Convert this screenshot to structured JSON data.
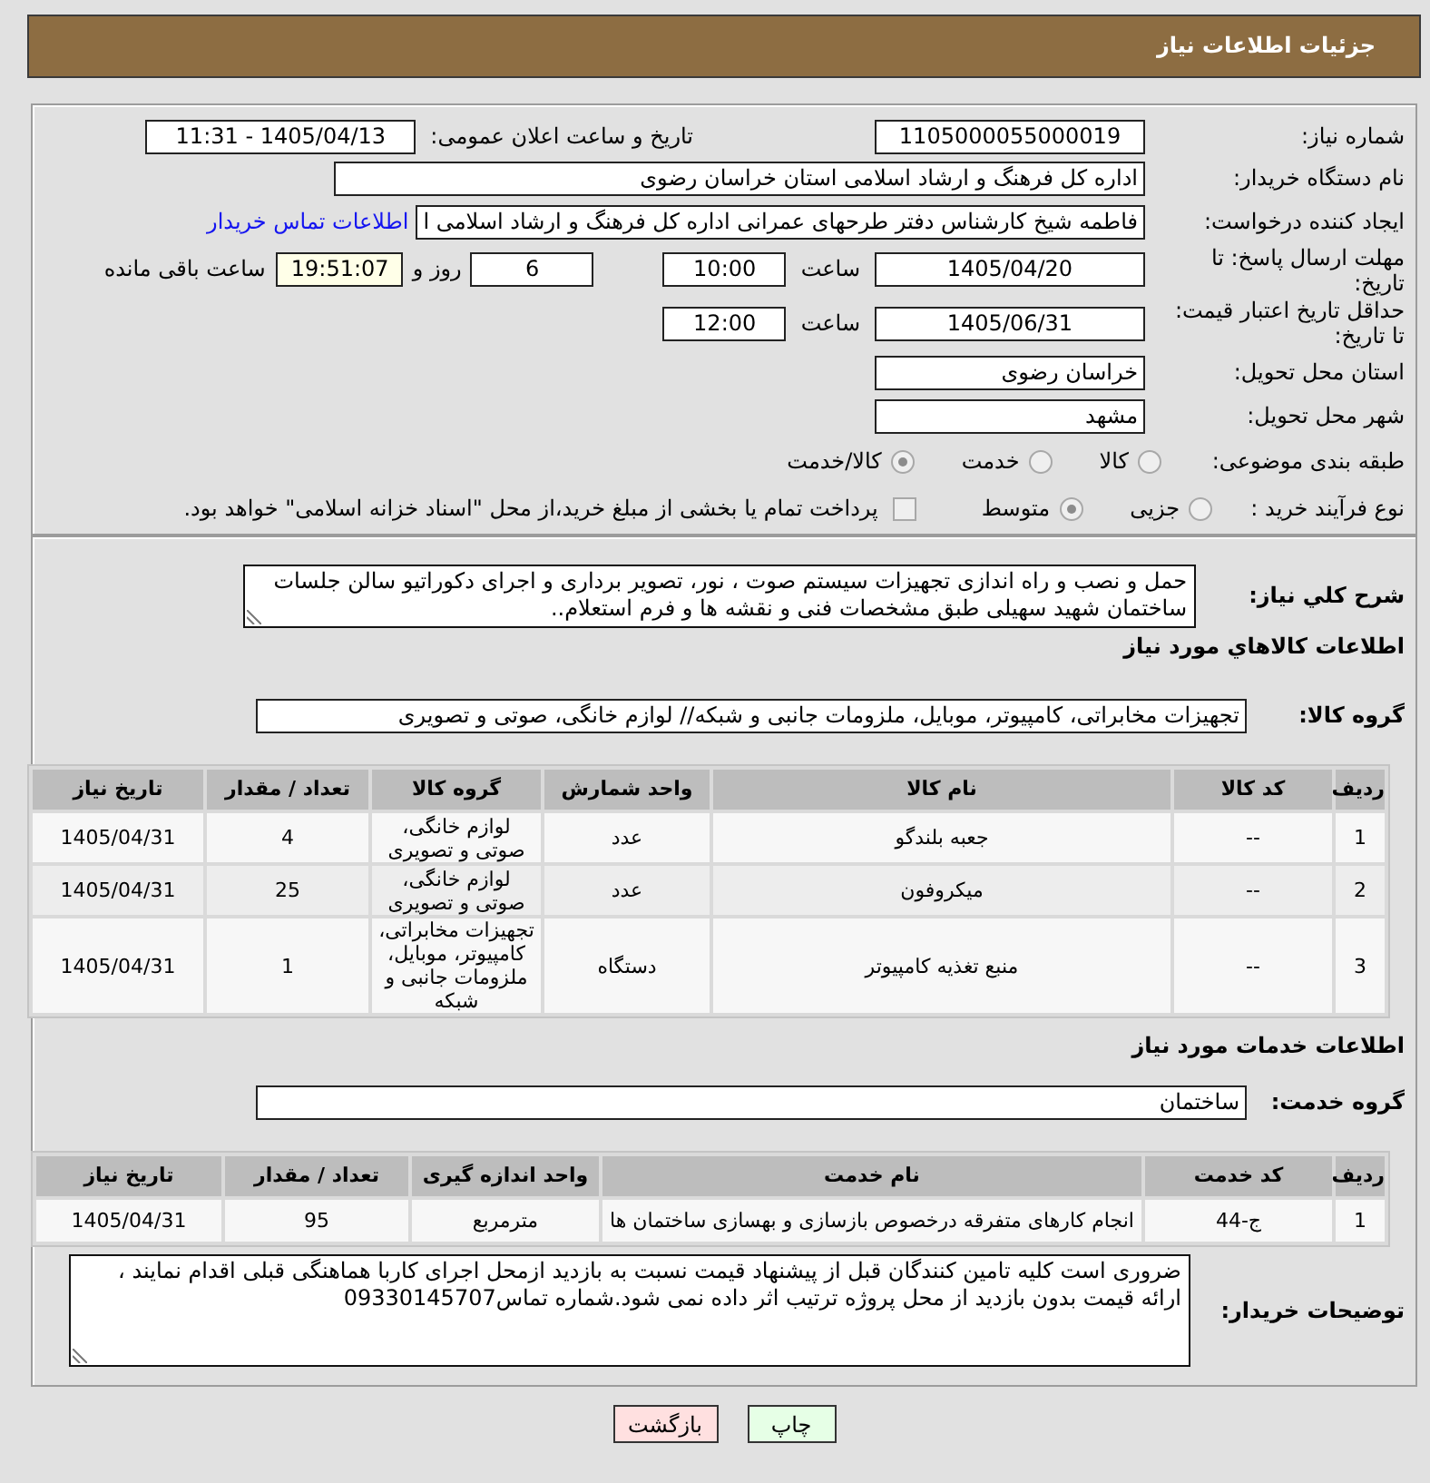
{
  "header": {
    "title": "جزئیات اطلاعات نیاز"
  },
  "details": {
    "need_number": {
      "label": "شماره نیاز:",
      "value": "1105000055000019"
    },
    "announce": {
      "label": "تاریخ و ساعت اعلان عمومی:",
      "value": "1405/04/13 - 11:31"
    },
    "buyer_org": {
      "label": "نام دستگاه خریدار:",
      "value": "اداره کل فرهنگ و ارشاد اسلامی استان خراسان رضوی"
    },
    "requester": {
      "label": "ایجاد کننده درخواست:",
      "value": "فاطمه شیخ کارشناس دفتر طرحهای عمرانی اداره کل فرهنگ و ارشاد اسلامی ا",
      "link": "اطلاعات تماس خریدار"
    },
    "reply_deadline": {
      "label": "مهلت ارسال پاسخ: تا تاریخ:",
      "date": "1405/04/20",
      "time_label": "ساعت",
      "time": "10:00",
      "days": "6",
      "days_label": "روز و",
      "remaining": "19:51:07",
      "remaining_label": "ساعت باقی مانده"
    },
    "price_validity": {
      "label": "حداقل تاریخ اعتبار قیمت: تا تاریخ:",
      "date": "1405/06/31",
      "time_label": "ساعت",
      "time": "12:00"
    },
    "province": {
      "label": "استان محل تحویل:",
      "value": "خراسان رضوی"
    },
    "city": {
      "label": "شهر محل تحویل:",
      "value": "مشهد"
    },
    "category": {
      "label": "طبقه بندی موضوعی:",
      "options": [
        {
          "label": "کالا",
          "selected": false
        },
        {
          "label": "خدمت",
          "selected": false
        },
        {
          "label": "کالا/خدمت",
          "selected": true
        }
      ]
    },
    "process": {
      "label": "نوع فرآیند خرید :",
      "options": [
        {
          "label": "جزیی",
          "selected": false
        },
        {
          "label": "متوسط",
          "selected": true
        }
      ],
      "payment": {
        "label": "پرداخت تمام یا بخشی از مبلغ خرید،از محل \"اسناد خزانه اسلامی\" خواهد بود.",
        "checked": false
      }
    }
  },
  "description": {
    "label": "شرح کلي نیاز:",
    "text": "حمل و نصب و راه اندازی تجهیزات سیستم صوت ، نور، تصویر برداری و اجرای دکوراتیو سالن جلسات ساختمان شهید سهیلی طبق مشخصات فنی و نقشه ها و فرم استعلام.."
  },
  "goods": {
    "title": "اطلاعات کالاهاي مورد نیاز",
    "group_label": "گروه کالا:",
    "group": "تجهیزات مخابراتی، کامپیوتر، موبایل، ملزومات جانبی و شبکه// لوازم خانگی، صوتی و تصویری",
    "table": {
      "columns": [
        "ردیف",
        "کد کالا",
        "نام کالا",
        "واحد شمارش",
        "گروه کالا",
        "تعداد / مقدار",
        "تاریخ نیاز"
      ],
      "rows": [
        [
          "1",
          "--",
          "جعبه بلندگو",
          "عدد",
          "لوازم خانگی، صوتی و تصویری",
          "4",
          "1405/04/31"
        ],
        [
          "2",
          "--",
          "میکروفون",
          "عدد",
          "لوازم خانگی، صوتی و تصویری",
          "25",
          "1405/04/31"
        ],
        [
          "3",
          "--",
          "منبع تغذیه کامپیوتر",
          "دستگاه",
          "تجهیزات مخابراتی، کامپیوتر، موبایل، ملزومات جانبی و شبکه",
          "1",
          "1405/04/31"
        ]
      ]
    }
  },
  "services": {
    "title": "اطلاعات خدمات مورد نیاز",
    "group_label": "گروه خدمت:",
    "group": "ساختمان",
    "table": {
      "columns": [
        "ردیف",
        "کد خدمت",
        "نام خدمت",
        "واحد اندازه گیری",
        "تعداد / مقدار",
        "تاریخ نیاز"
      ],
      "rows": [
        [
          "1",
          "ج-44",
          "انجام کارهای متفرقه درخصوص بازسازی و بهسازی ساختمان ها",
          "مترمربع",
          "95",
          "1405/04/31"
        ]
      ]
    }
  },
  "buyer_notes": {
    "label": "توضیحات خریدار:",
    "text": "ضروری است کلیه تامین کنندگان قبل از پیشنهاد قیمت نسبت به بازدید ازمحل اجرای کاربا هماهنگی قبلی اقدام نمایند ، ارائه قیمت بدون بازدید از محل پروژه ترتیب اثر داده نمی شود.شماره تماس09330145707"
  },
  "buttons": [
    {
      "label": "چاپ",
      "kind": "print"
    },
    {
      "label": "بازگشت",
      "kind": "back"
    }
  ]
}
